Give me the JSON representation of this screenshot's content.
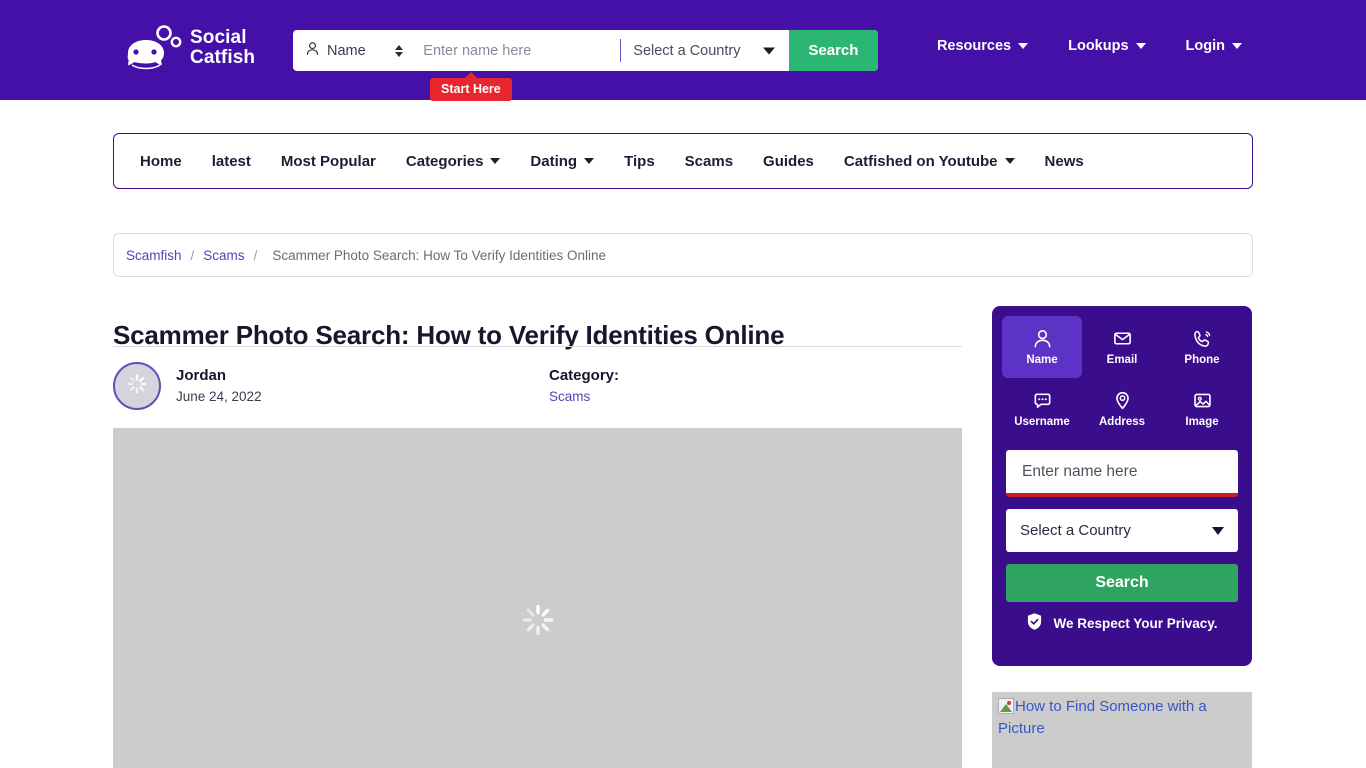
{
  "header": {
    "logo_name": "Social Catfish",
    "logo_line1": "Social",
    "logo_line2": "Catfish",
    "search": {
      "type_label": "Name",
      "type_icon": "person-icon",
      "name_placeholder": "Enter name here",
      "name_value": "",
      "country_label": "Select a Country",
      "search_button": "Search",
      "badge": "Start Here"
    },
    "nav": [
      {
        "label": "Resources",
        "has_caret": true
      },
      {
        "label": "Lookups",
        "has_caret": true
      },
      {
        "label": "Login",
        "has_caret": true
      }
    ],
    "bg_color": "#4410a8",
    "accent_green": "#2bb673",
    "badge_red": "#e8262d"
  },
  "mainnav": [
    {
      "label": "Home",
      "has_caret": false
    },
    {
      "label": "latest",
      "has_caret": false
    },
    {
      "label": "Most Popular",
      "has_caret": false
    },
    {
      "label": "Categories",
      "has_caret": true
    },
    {
      "label": "Dating",
      "has_caret": true
    },
    {
      "label": "Tips",
      "has_caret": false
    },
    {
      "label": "Scams",
      "has_caret": false
    },
    {
      "label": "Guides",
      "has_caret": false
    },
    {
      "label": "Catfished on Youtube",
      "has_caret": true
    },
    {
      "label": "News",
      "has_caret": false
    }
  ],
  "breadcrumb": {
    "items": [
      {
        "label": "Scamfish",
        "link": true
      },
      {
        "label": "Scams",
        "link": true
      }
    ],
    "separator": "/",
    "current": "Scammer Photo Search: How To Verify Identities Online"
  },
  "article": {
    "title": "Scammer Photo Search: How to Verify Identities Online",
    "author": "Jordan",
    "date": "June 24, 2022",
    "category_label": "Category:",
    "category_value": "Scams",
    "hero_state": "loading"
  },
  "sidebar": {
    "tabs": [
      {
        "label": "Name",
        "icon": "person-icon",
        "active": true
      },
      {
        "label": "Email",
        "icon": "envelope-icon",
        "active": false
      },
      {
        "label": "Phone",
        "icon": "phone-icon",
        "active": false
      },
      {
        "label": "Username",
        "icon": "chat-bubble-icon",
        "active": false
      },
      {
        "label": "Address",
        "icon": "map-pin-icon",
        "active": false
      },
      {
        "label": "Image",
        "icon": "image-icon",
        "active": false
      }
    ],
    "name_placeholder": "Enter name here",
    "name_value": "",
    "country_label": "Select a Country",
    "search_button": "Search",
    "privacy_text": "We Respect Your Privacy.",
    "privacy_icon": "shield-check-icon",
    "bg_color": "#3a0d8c",
    "active_tab_color": "#5c33c4",
    "button_color": "#2fa360",
    "underline_color": "#c32026"
  },
  "promo": {
    "alt_text": "How to Find Someone with a Picture",
    "state": "broken-image"
  }
}
